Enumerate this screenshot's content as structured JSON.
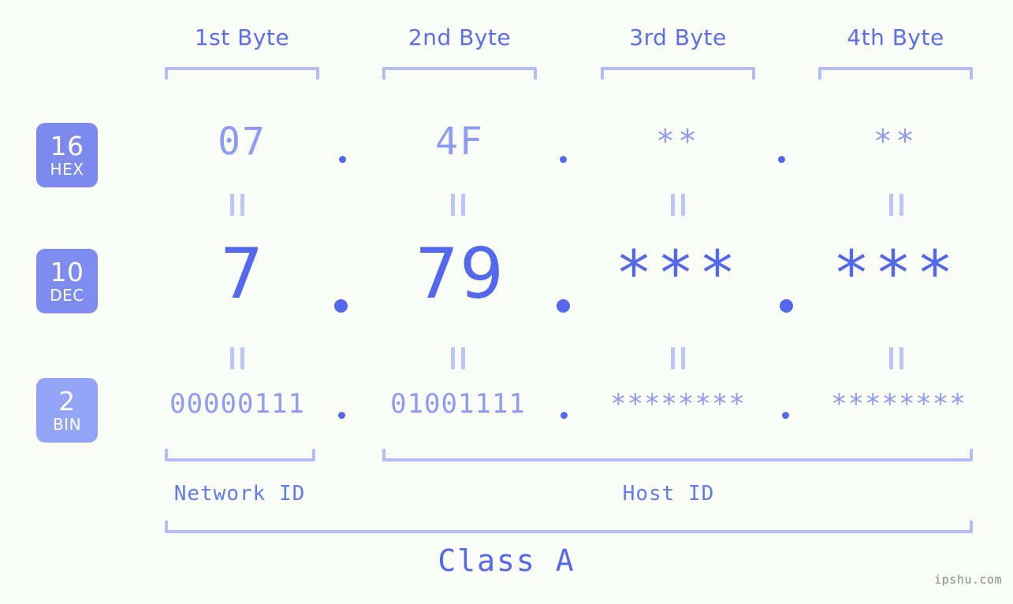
{
  "meta": {
    "background_color": "#fafdf7",
    "accent_strong": "#5368ed",
    "accent_mid": "#8d9bf2",
    "accent_light": "#b3bdf7",
    "badge_text_color": "#ffffff"
  },
  "headers": [
    {
      "label": "1st Byte"
    },
    {
      "label": "2nd Byte"
    },
    {
      "label": "3rd Byte"
    },
    {
      "label": "4th Byte"
    }
  ],
  "bases": [
    {
      "num": "16",
      "name": "HEX",
      "color": "#7b8aec"
    },
    {
      "num": "10",
      "name": "DEC",
      "color": "#7d8cee"
    },
    {
      "num": "2",
      "name": "BIN",
      "color": "#94a4f7"
    }
  ],
  "rows": {
    "hex": {
      "values": [
        "07",
        "4F",
        "**",
        "**"
      ]
    },
    "dec": {
      "values": [
        "7",
        "79",
        "***",
        "***"
      ]
    },
    "bin": {
      "values": [
        "00000111",
        "01001111",
        "********",
        "********"
      ]
    }
  },
  "separators": {
    "dot": ".",
    "equals_mark": "||"
  },
  "segments": {
    "network_id": "Network ID",
    "host_id": "Host ID"
  },
  "class_label": "Class A",
  "watermark": "ipshu.com"
}
